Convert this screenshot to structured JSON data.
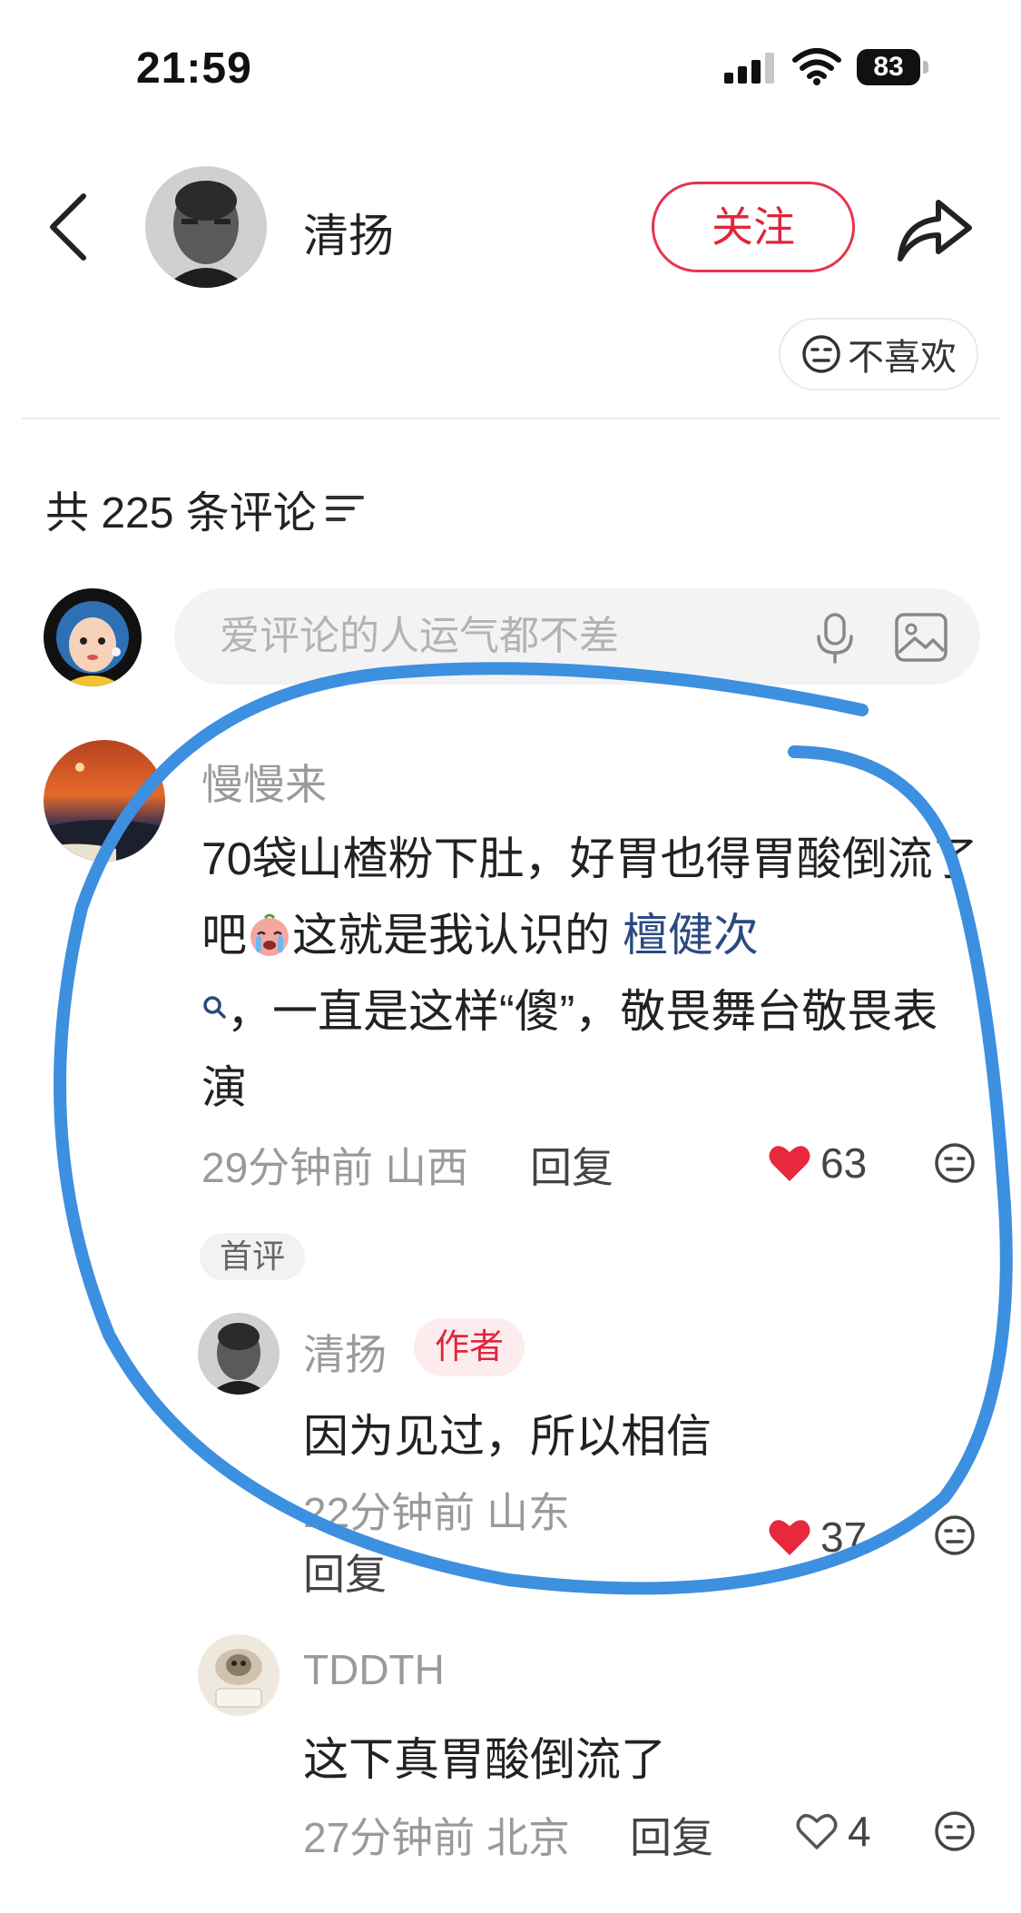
{
  "status_bar": {
    "time": "21:59",
    "battery": "83"
  },
  "header": {
    "username": "清扬",
    "follow_label": "关注"
  },
  "dislike_label": "不喜欢",
  "comments_header": {
    "title": "共 225 条评论"
  },
  "input": {
    "placeholder": "爱评论的人运气都不差"
  },
  "comments": [
    {
      "user": "慢慢来",
      "text_part1": "70袋山楂粉下肚，好胃也得胃酸倒流了吧",
      "text_part2": "这就是我认识的",
      "topic": "檀健次",
      "text_part3": "，一直是这样“傻”，敬畏舞台敬畏表演",
      "time_location": "29分钟前 山西",
      "reply_label": "回复",
      "likes": "63",
      "badge": "首评",
      "replies": [
        {
          "user": "清扬",
          "badge": "作者",
          "text": "因为见过，所以相信",
          "time_location": "22分钟前 山东",
          "reply_label": "回复",
          "likes": "37"
        },
        {
          "user": "TDDTH",
          "text": "这下真胃酸倒流了",
          "time_location": "27分钟前 北京",
          "reply_label": "回复",
          "likes": "4"
        }
      ]
    }
  ],
  "colors": {
    "accent": "#e0253d",
    "like_red": "#e8283c",
    "topic_blue": "#2a4a80",
    "annotation_blue": "#3d8fe0"
  },
  "icons": [
    "back-icon",
    "share-icon",
    "neutral-face-icon",
    "sort-icon",
    "mic-icon",
    "image-icon",
    "heart-icon",
    "search-small-icon",
    "crying-face-emoji"
  ]
}
